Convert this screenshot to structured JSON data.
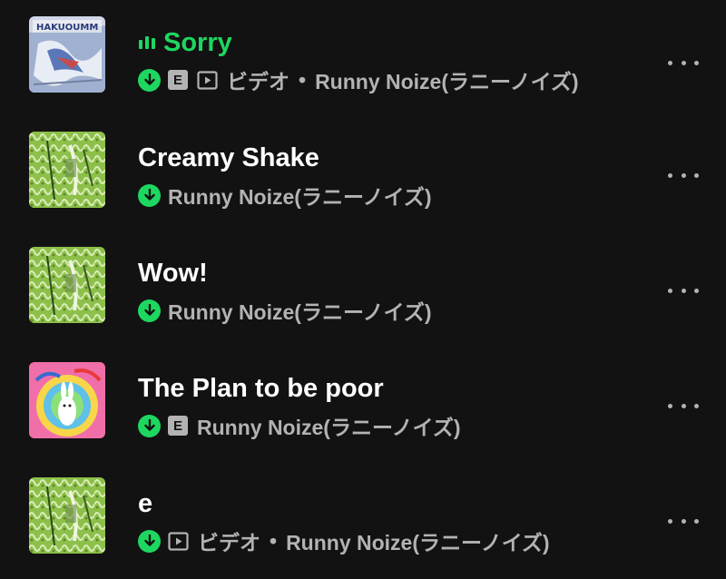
{
  "colors": {
    "background": "#121212",
    "accent_green": "#1ed760",
    "text_primary": "#ffffff",
    "text_secondary": "#b3b3b3"
  },
  "tracks": [
    {
      "title": "Sorry",
      "playing": true,
      "downloaded": true,
      "explicit": true,
      "explicit_label": "E",
      "video": true,
      "video_label": "ビデオ",
      "separator": "•",
      "artist": "Runny Noize(ラニーノイズ)",
      "icons": [
        "equalizer-icon",
        "download-icon",
        "explicit-icon",
        "video-icon",
        "more-icon"
      ]
    },
    {
      "title": "Creamy Shake",
      "playing": false,
      "downloaded": true,
      "explicit": false,
      "video": false,
      "artist": "Runny Noize(ラニーノイズ)",
      "icons": [
        "download-icon",
        "more-icon"
      ]
    },
    {
      "title": "Wow!",
      "playing": false,
      "downloaded": true,
      "explicit": false,
      "video": false,
      "artist": "Runny Noize(ラニーノイズ)",
      "icons": [
        "download-icon",
        "more-icon"
      ]
    },
    {
      "title": "The Plan to be poor",
      "playing": false,
      "downloaded": true,
      "explicit": true,
      "explicit_label": "E",
      "video": false,
      "artist": "Runny Noize(ラニーノイズ)",
      "icons": [
        "download-icon",
        "explicit-icon",
        "more-icon"
      ]
    },
    {
      "title": "e",
      "playing": false,
      "downloaded": true,
      "explicit": false,
      "video": true,
      "video_label": "ビデオ",
      "separator": "•",
      "artist": "Runny Noize(ラニーノイズ)",
      "icons": [
        "download-icon",
        "video-icon",
        "more-icon"
      ]
    }
  ]
}
